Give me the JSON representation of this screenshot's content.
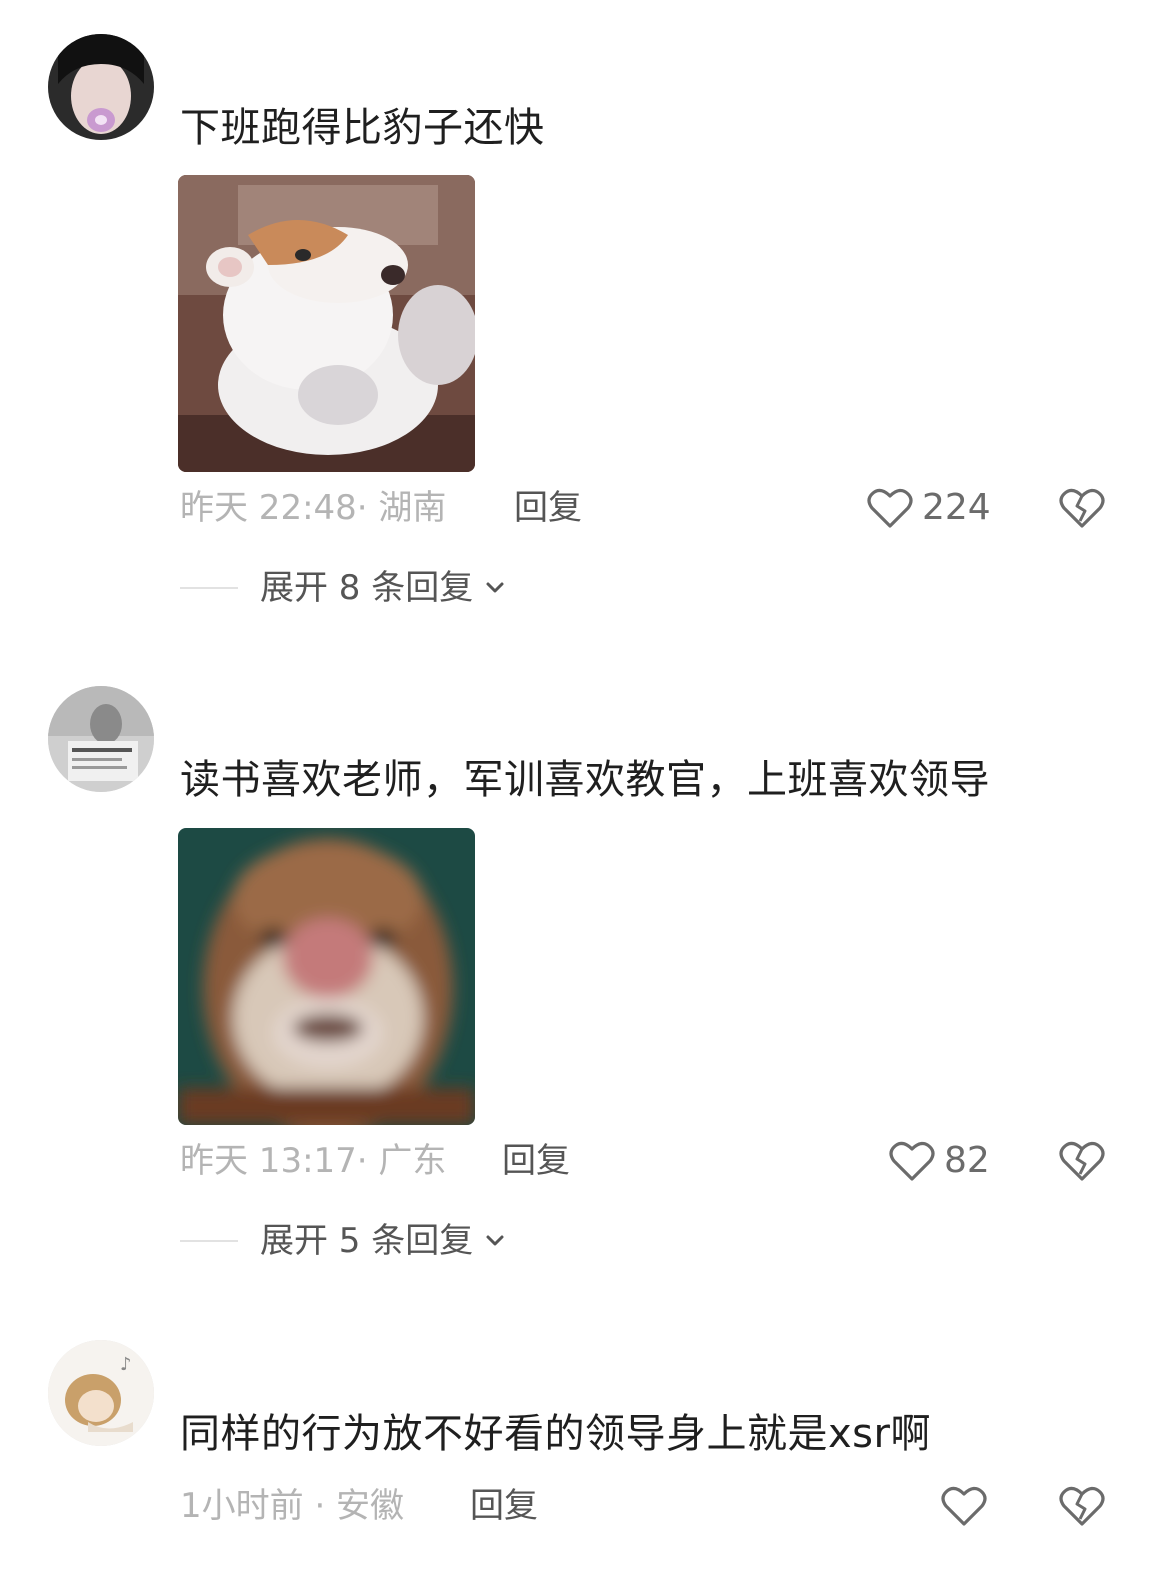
{
  "comments": [
    {
      "text": "下班跑得比豹子还快",
      "meta": "昨天 22:48· 湖南",
      "reply_label": "回复",
      "like_count": "224",
      "expand_label": "展开 8 条回复"
    },
    {
      "text": "读书喜欢老师，军训喜欢教官，上班喜欢领导",
      "meta": "昨天 13:17· 广东",
      "reply_label": "回复",
      "like_count": "82",
      "expand_label": "展开 5 条回复"
    },
    {
      "text": "同样的行为放不好看的领导身上就是xsr啊",
      "meta": "1小时前 · 安徽",
      "reply_label": "回复",
      "like_count": ""
    }
  ],
  "icons": {
    "like": "heart-outline-icon",
    "dislike": "broken-heart-icon",
    "expand": "chevron-down-icon"
  },
  "colors": {
    "meta_text": "#b4b4b4",
    "action_text": "#555555",
    "icon": "#6b6b6b"
  }
}
